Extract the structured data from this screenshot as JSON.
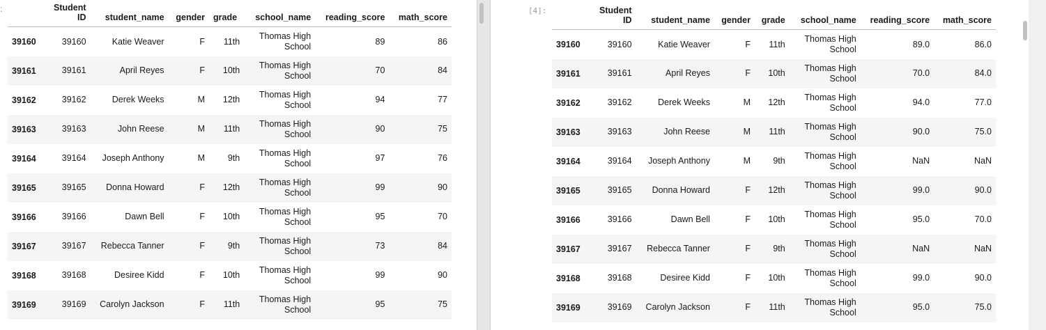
{
  "left_pane": {
    "edge_marker": ":",
    "columns": [
      "Student ID",
      "student_name",
      "gender",
      "grade",
      "school_name",
      "reading_score",
      "math_score"
    ],
    "rows": [
      {
        "index": "39160",
        "cells": [
          "39160",
          "Katie Weaver",
          "F",
          "11th",
          "Thomas High School",
          "89",
          "86"
        ]
      },
      {
        "index": "39161",
        "cells": [
          "39161",
          "April Reyes",
          "F",
          "10th",
          "Thomas High School",
          "70",
          "84"
        ]
      },
      {
        "index": "39162",
        "cells": [
          "39162",
          "Derek Weeks",
          "M",
          "12th",
          "Thomas High School",
          "94",
          "77"
        ]
      },
      {
        "index": "39163",
        "cells": [
          "39163",
          "John Reese",
          "M",
          "11th",
          "Thomas High School",
          "90",
          "75"
        ]
      },
      {
        "index": "39164",
        "cells": [
          "39164",
          "Joseph Anthony",
          "M",
          "9th",
          "Thomas High School",
          "97",
          "76"
        ]
      },
      {
        "index": "39165",
        "cells": [
          "39165",
          "Donna Howard",
          "F",
          "12th",
          "Thomas High School",
          "99",
          "90"
        ]
      },
      {
        "index": "39166",
        "cells": [
          "39166",
          "Dawn Bell",
          "F",
          "10th",
          "Thomas High School",
          "95",
          "70"
        ]
      },
      {
        "index": "39167",
        "cells": [
          "39167",
          "Rebecca Tanner",
          "F",
          "9th",
          "Thomas High School",
          "73",
          "84"
        ]
      },
      {
        "index": "39168",
        "cells": [
          "39168",
          "Desiree Kidd",
          "F",
          "10th",
          "Thomas High School",
          "99",
          "90"
        ]
      },
      {
        "index": "39169",
        "cells": [
          "39169",
          "Carolyn Jackson",
          "F",
          "11th",
          "Thomas High School",
          "95",
          "75"
        ]
      }
    ]
  },
  "right_pane": {
    "prompt": "[4]:",
    "columns": [
      "Student ID",
      "student_name",
      "gender",
      "grade",
      "school_name",
      "reading_score",
      "math_score"
    ],
    "rows": [
      {
        "index": "39160",
        "cells": [
          "39160",
          "Katie Weaver",
          "F",
          "11th",
          "Thomas High School",
          "89.0",
          "86.0"
        ]
      },
      {
        "index": "39161",
        "cells": [
          "39161",
          "April Reyes",
          "F",
          "10th",
          "Thomas High School",
          "70.0",
          "84.0"
        ]
      },
      {
        "index": "39162",
        "cells": [
          "39162",
          "Derek Weeks",
          "M",
          "12th",
          "Thomas High School",
          "94.0",
          "77.0"
        ]
      },
      {
        "index": "39163",
        "cells": [
          "39163",
          "John Reese",
          "M",
          "11th",
          "Thomas High School",
          "90.0",
          "75.0"
        ]
      },
      {
        "index": "39164",
        "cells": [
          "39164",
          "Joseph Anthony",
          "M",
          "9th",
          "Thomas High School",
          "NaN",
          "NaN"
        ]
      },
      {
        "index": "39165",
        "cells": [
          "39165",
          "Donna Howard",
          "F",
          "12th",
          "Thomas High School",
          "99.0",
          "90.0"
        ]
      },
      {
        "index": "39166",
        "cells": [
          "39166",
          "Dawn Bell",
          "F",
          "10th",
          "Thomas High School",
          "95.0",
          "70.0"
        ]
      },
      {
        "index": "39167",
        "cells": [
          "39167",
          "Rebecca Tanner",
          "F",
          "9th",
          "Thomas High School",
          "NaN",
          "NaN"
        ]
      },
      {
        "index": "39168",
        "cells": [
          "39168",
          "Desiree Kidd",
          "F",
          "10th",
          "Thomas High School",
          "99.0",
          "90.0"
        ]
      },
      {
        "index": "39169",
        "cells": [
          "39169",
          "Carolyn Jackson",
          "F",
          "11th",
          "Thomas High School",
          "95.0",
          "75.0"
        ]
      }
    ]
  }
}
